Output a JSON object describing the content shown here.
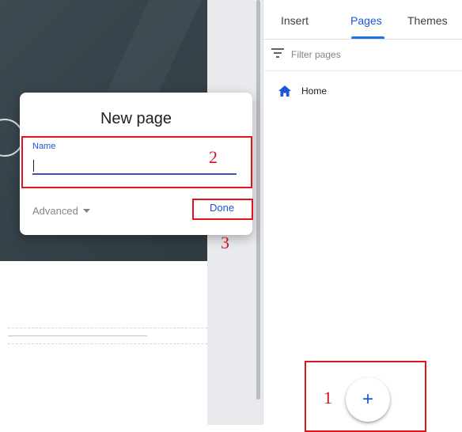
{
  "panel": {
    "tabs": [
      {
        "label": "Insert"
      },
      {
        "label": "Pages"
      },
      {
        "label": "Themes"
      }
    ],
    "active_tab": "Pages",
    "filter": {
      "placeholder": "Filter pages"
    },
    "pages": [
      {
        "label": "Home",
        "icon": "home-icon"
      }
    ],
    "fab": {
      "icon": "plus-icon",
      "symbol": "+"
    }
  },
  "dialog": {
    "title": "New page",
    "name_field": {
      "label": "Name",
      "value": ""
    },
    "advanced_label": "Advanced",
    "done_label": "Done"
  },
  "annotations": {
    "markers": [
      "1",
      "2",
      "3"
    ]
  },
  "colors": {
    "accent": "#1a56d6",
    "annotation_red": "#e0141c",
    "hero_bg": "#3d4a51"
  }
}
